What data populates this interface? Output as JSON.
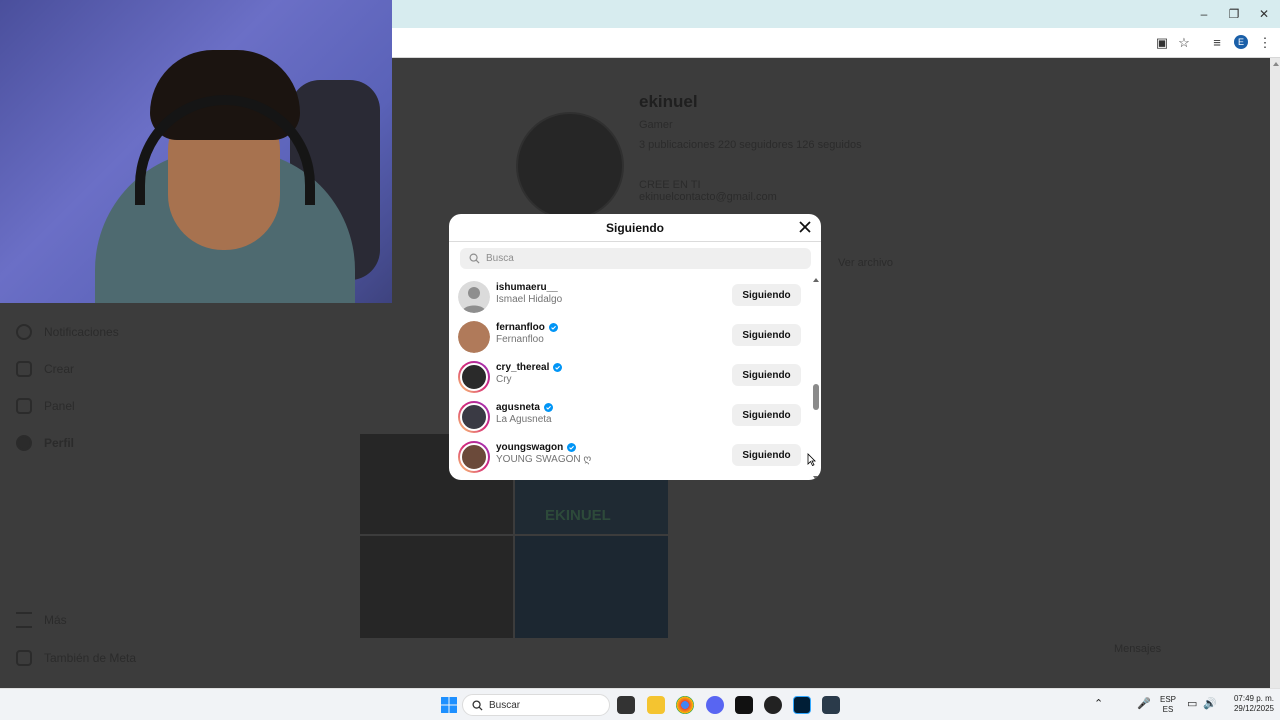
{
  "modal": {
    "title": "Siguiendo",
    "search_placeholder": "Busca",
    "follow_button_label": "Siguiendo",
    "rows": [
      {
        "username": "ishumaeru__",
        "fullname": "Ismael Hidalgo",
        "verified": false,
        "avatar_color": "#dbdbdb"
      },
      {
        "username": "fernanfloo",
        "fullname": "Fernanfloo",
        "verified": true,
        "avatar_color": "#b07a5a"
      },
      {
        "username": "cry_thereal",
        "fullname": "Cry",
        "verified": true,
        "avatar_color": "#2a2a2a"
      },
      {
        "username": "agusneta",
        "fullname": "La Agusneta",
        "verified": true,
        "avatar_color": "#3a3a44"
      },
      {
        "username": "youngswagon",
        "fullname": "YOUNG SWAGON ღ",
        "verified": true,
        "avatar_color": "#6b4a3a"
      }
    ],
    "scroll_fraction": 0.55
  },
  "background_profile": {
    "username": "ekinuel",
    "category": "Gamer",
    "stats": "3 publicaciones   220 seguidores   126 seguidos",
    "bio_line": "CREE EN TI",
    "email_line": "ekinuelcontacto@gmail.com",
    "message_button": "Ver archivo"
  },
  "sidebar": {
    "items": [
      {
        "label": "Notificaciones",
        "icon": "heart-icon"
      },
      {
        "label": "Crear",
        "icon": "plus-icon"
      },
      {
        "label": "Panel",
        "icon": "dashboard-icon"
      },
      {
        "label": "Perfil",
        "icon": "profile-icon"
      },
      {
        "label": "Más",
        "icon": "menu-icon"
      },
      {
        "label": "También de Meta",
        "icon": "meta-icon"
      }
    ]
  },
  "messages_button": "Mensajes",
  "post_text": "EKINUEL",
  "taskbar": {
    "search_label": "Buscar",
    "language_top": "ESP",
    "language_bottom": "ES",
    "time": "07:49 p. m.",
    "date": "29/12/2025"
  },
  "colors": {
    "verified": "#0095f6",
    "modal_bg": "#ffffff",
    "button_bg": "#efefef"
  }
}
